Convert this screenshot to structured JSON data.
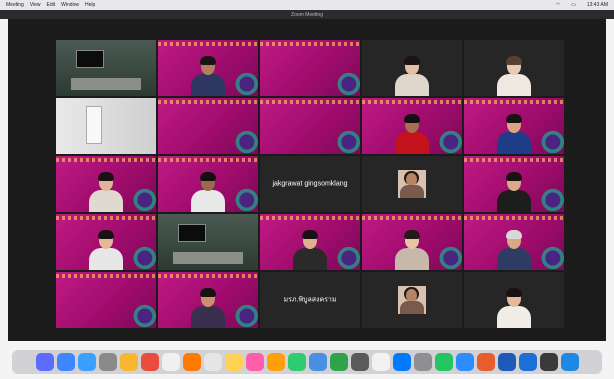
{
  "menubar": {
    "items": [
      "Meeting",
      "View",
      "Edit",
      "Window",
      "Help"
    ],
    "time": "13:43 AM"
  },
  "window": {
    "title": "Zoom Meeting"
  },
  "tiles": [
    {
      "kind": "video",
      "bg": "room",
      "active": true
    },
    {
      "kind": "video",
      "bg": "pink",
      "person": {
        "skin": "#b0805f",
        "hair": "#1a1414",
        "shirt": "#2d3760"
      }
    },
    {
      "kind": "video",
      "bg": "pink"
    },
    {
      "kind": "video",
      "bg": "dark",
      "person": {
        "skin": "#e2c0a8",
        "hair": "#1a1414",
        "shirt": "#dfd6cc"
      }
    },
    {
      "kind": "video",
      "bg": "dark",
      "person": {
        "skin": "#e6cbb5",
        "hair": "#5a4030",
        "shirt": "#eee8e0"
      }
    },
    {
      "kind": "video",
      "bg": "white"
    },
    {
      "kind": "video",
      "bg": "pink"
    },
    {
      "kind": "video",
      "bg": "pink"
    },
    {
      "kind": "video",
      "bg": "pink",
      "person": {
        "skin": "#a7704e",
        "hair": "#141010",
        "shirt": "#c4121d"
      }
    },
    {
      "kind": "video",
      "bg": "pink",
      "person": {
        "skin": "#d9a583",
        "hair": "#1b1212",
        "shirt": "#1f3c88"
      }
    },
    {
      "kind": "video",
      "bg": "pink",
      "person": {
        "skin": "#e1b597",
        "hair": "#1a1212",
        "shirt": "#e0d9d0"
      }
    },
    {
      "kind": "video",
      "bg": "pink",
      "person": {
        "skin": "#9a6a4a",
        "hair": "#141010",
        "shirt": "#e8e8e8"
      }
    },
    {
      "kind": "name",
      "name": "jakgrawat gingsomklang"
    },
    {
      "kind": "thumb"
    },
    {
      "kind": "video",
      "bg": "pink",
      "person": {
        "skin": "#d8a98a",
        "hair": "#1a1212",
        "shirt": "#1d1d1d"
      }
    },
    {
      "kind": "video",
      "bg": "pink",
      "person": {
        "skin": "#e4b899",
        "hair": "#1a1212",
        "shirt": "#e7e7e7"
      }
    },
    {
      "kind": "video",
      "bg": "room2"
    },
    {
      "kind": "video",
      "bg": "pink",
      "person": {
        "skin": "#deb092",
        "hair": "#1a1212",
        "shirt": "#2a2a2a"
      }
    },
    {
      "kind": "video",
      "bg": "pink",
      "person": {
        "skin": "#e8c4a7",
        "hair": "#241a18",
        "shirt": "#c7b9a9"
      }
    },
    {
      "kind": "video",
      "bg": "pink",
      "person": {
        "skin": "#d7a986",
        "hair": "#d8d8d8",
        "shirt": "#2e3c64"
      }
    },
    {
      "kind": "video",
      "bg": "pink"
    },
    {
      "kind": "video",
      "bg": "pink",
      "person": {
        "skin": "#c9916e",
        "hair": "#1a1212",
        "shirt": "#3b2f4f"
      }
    },
    {
      "kind": "name",
      "name": "มรภ.พิบูลสงคราม"
    },
    {
      "kind": "thumb"
    },
    {
      "kind": "video",
      "bg": "dark",
      "person": {
        "skin": "#e6b99a",
        "hair": "#1a1212",
        "shirt": "#f0ece6"
      }
    }
  ],
  "dock": {
    "apps": [
      "#5b6cff",
      "#3d86ff",
      "#3aa0ff",
      "#8a8a8a",
      "#f7b731",
      "#e74c3c",
      "#f0f0f0",
      "#ff7a00",
      "#e5e5e5",
      "#ffd257",
      "#ff5cab",
      "#ff9f0a",
      "#2ecc71",
      "#4a90e2",
      "#2ea34a",
      "#5a5a5a",
      "#f2f2f2",
      "#007aff",
      "#8e8e93",
      "#22c55e",
      "#2d8cff",
      "#e85d2e",
      "#1e5bb8",
      "#1d6fd8",
      "#3a3a3a",
      "#1e88e5"
    ]
  }
}
